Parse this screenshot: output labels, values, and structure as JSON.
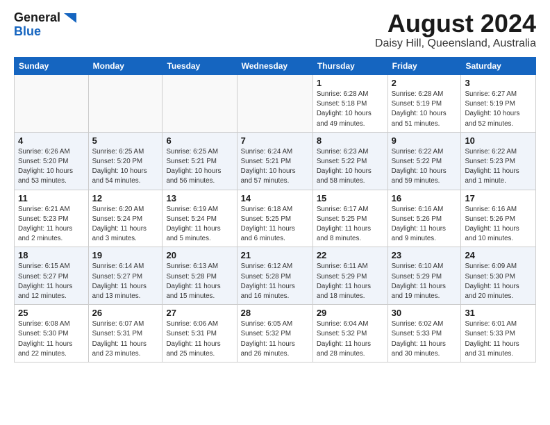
{
  "logo": {
    "line1": "General",
    "line2": "Blue"
  },
  "title": "August 2024",
  "location": "Daisy Hill, Queensland, Australia",
  "weekdays": [
    "Sunday",
    "Monday",
    "Tuesday",
    "Wednesday",
    "Thursday",
    "Friday",
    "Saturday"
  ],
  "weeks": [
    [
      {
        "day": "",
        "info": ""
      },
      {
        "day": "",
        "info": ""
      },
      {
        "day": "",
        "info": ""
      },
      {
        "day": "",
        "info": ""
      },
      {
        "day": "1",
        "info": "Sunrise: 6:28 AM\nSunset: 5:18 PM\nDaylight: 10 hours\nand 49 minutes."
      },
      {
        "day": "2",
        "info": "Sunrise: 6:28 AM\nSunset: 5:19 PM\nDaylight: 10 hours\nand 51 minutes."
      },
      {
        "day": "3",
        "info": "Sunrise: 6:27 AM\nSunset: 5:19 PM\nDaylight: 10 hours\nand 52 minutes."
      }
    ],
    [
      {
        "day": "4",
        "info": "Sunrise: 6:26 AM\nSunset: 5:20 PM\nDaylight: 10 hours\nand 53 minutes."
      },
      {
        "day": "5",
        "info": "Sunrise: 6:25 AM\nSunset: 5:20 PM\nDaylight: 10 hours\nand 54 minutes."
      },
      {
        "day": "6",
        "info": "Sunrise: 6:25 AM\nSunset: 5:21 PM\nDaylight: 10 hours\nand 56 minutes."
      },
      {
        "day": "7",
        "info": "Sunrise: 6:24 AM\nSunset: 5:21 PM\nDaylight: 10 hours\nand 57 minutes."
      },
      {
        "day": "8",
        "info": "Sunrise: 6:23 AM\nSunset: 5:22 PM\nDaylight: 10 hours\nand 58 minutes."
      },
      {
        "day": "9",
        "info": "Sunrise: 6:22 AM\nSunset: 5:22 PM\nDaylight: 10 hours\nand 59 minutes."
      },
      {
        "day": "10",
        "info": "Sunrise: 6:22 AM\nSunset: 5:23 PM\nDaylight: 11 hours\nand 1 minute."
      }
    ],
    [
      {
        "day": "11",
        "info": "Sunrise: 6:21 AM\nSunset: 5:23 PM\nDaylight: 11 hours\nand 2 minutes."
      },
      {
        "day": "12",
        "info": "Sunrise: 6:20 AM\nSunset: 5:24 PM\nDaylight: 11 hours\nand 3 minutes."
      },
      {
        "day": "13",
        "info": "Sunrise: 6:19 AM\nSunset: 5:24 PM\nDaylight: 11 hours\nand 5 minutes."
      },
      {
        "day": "14",
        "info": "Sunrise: 6:18 AM\nSunset: 5:25 PM\nDaylight: 11 hours\nand 6 minutes."
      },
      {
        "day": "15",
        "info": "Sunrise: 6:17 AM\nSunset: 5:25 PM\nDaylight: 11 hours\nand 8 minutes."
      },
      {
        "day": "16",
        "info": "Sunrise: 6:16 AM\nSunset: 5:26 PM\nDaylight: 11 hours\nand 9 minutes."
      },
      {
        "day": "17",
        "info": "Sunrise: 6:16 AM\nSunset: 5:26 PM\nDaylight: 11 hours\nand 10 minutes."
      }
    ],
    [
      {
        "day": "18",
        "info": "Sunrise: 6:15 AM\nSunset: 5:27 PM\nDaylight: 11 hours\nand 12 minutes."
      },
      {
        "day": "19",
        "info": "Sunrise: 6:14 AM\nSunset: 5:27 PM\nDaylight: 11 hours\nand 13 minutes."
      },
      {
        "day": "20",
        "info": "Sunrise: 6:13 AM\nSunset: 5:28 PM\nDaylight: 11 hours\nand 15 minutes."
      },
      {
        "day": "21",
        "info": "Sunrise: 6:12 AM\nSunset: 5:28 PM\nDaylight: 11 hours\nand 16 minutes."
      },
      {
        "day": "22",
        "info": "Sunrise: 6:11 AM\nSunset: 5:29 PM\nDaylight: 11 hours\nand 18 minutes."
      },
      {
        "day": "23",
        "info": "Sunrise: 6:10 AM\nSunset: 5:29 PM\nDaylight: 11 hours\nand 19 minutes."
      },
      {
        "day": "24",
        "info": "Sunrise: 6:09 AM\nSunset: 5:30 PM\nDaylight: 11 hours\nand 20 minutes."
      }
    ],
    [
      {
        "day": "25",
        "info": "Sunrise: 6:08 AM\nSunset: 5:30 PM\nDaylight: 11 hours\nand 22 minutes."
      },
      {
        "day": "26",
        "info": "Sunrise: 6:07 AM\nSunset: 5:31 PM\nDaylight: 11 hours\nand 23 minutes."
      },
      {
        "day": "27",
        "info": "Sunrise: 6:06 AM\nSunset: 5:31 PM\nDaylight: 11 hours\nand 25 minutes."
      },
      {
        "day": "28",
        "info": "Sunrise: 6:05 AM\nSunset: 5:32 PM\nDaylight: 11 hours\nand 26 minutes."
      },
      {
        "day": "29",
        "info": "Sunrise: 6:04 AM\nSunset: 5:32 PM\nDaylight: 11 hours\nand 28 minutes."
      },
      {
        "day": "30",
        "info": "Sunrise: 6:02 AM\nSunset: 5:33 PM\nDaylight: 11 hours\nand 30 minutes."
      },
      {
        "day": "31",
        "info": "Sunrise: 6:01 AM\nSunset: 5:33 PM\nDaylight: 11 hours\nand 31 minutes."
      }
    ]
  ]
}
